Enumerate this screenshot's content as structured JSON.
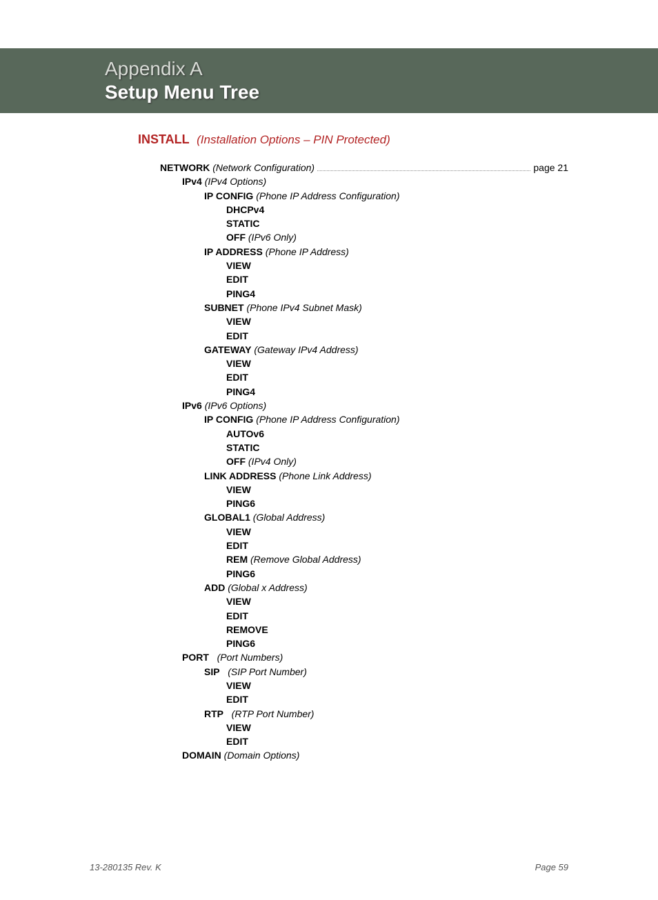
{
  "banner": {
    "appendix": "Appendix A",
    "title": "Setup Menu Tree"
  },
  "install": {
    "label": "INSTALL",
    "desc": "(Installation Options – PIN Protected)"
  },
  "network": {
    "label": "NETWORK",
    "desc": "(Network Configuration)",
    "page_ref": "page 21"
  },
  "ipv4": {
    "label": "IPv4",
    "desc": "(IPv4 Options)",
    "ipconfig": {
      "label": "IP CONFIG",
      "desc": "(Phone IP Address Configuration)"
    },
    "dhcpv4": "DHCPv4",
    "static": "STATIC",
    "off": {
      "label": "OFF",
      "desc": "(IPv6 Only)"
    },
    "ipaddress": {
      "label": "IP ADDRESS",
      "desc": "(Phone IP Address)"
    },
    "view1": "VIEW",
    "edit1": "EDIT",
    "ping4_1": "PING4",
    "subnet": {
      "label": "SUBNET",
      "desc": "(Phone IPv4 Subnet Mask)"
    },
    "view2": "VIEW",
    "edit2": "EDIT",
    "gateway": {
      "label": "GATEWAY",
      "desc": "(Gateway IPv4 Address)"
    },
    "view3": "VIEW",
    "edit3": "EDIT",
    "ping4_2": "PING4"
  },
  "ipv6": {
    "label": "IPv6",
    "desc": "(IPv6 Options)",
    "ipconfig": {
      "label": "IP CONFIG",
      "desc": "(Phone IP Address Configuration)"
    },
    "autov6": "AUTOv6",
    "static": "STATIC",
    "off": {
      "label": "OFF",
      "desc": "(IPv4 Only)"
    },
    "linkaddress": {
      "label": "LINK ADDRESS",
      "desc": "(Phone Link Address)"
    },
    "view1": "VIEW",
    "ping6_1": "PING6",
    "global1": {
      "label": "GLOBAL1",
      "desc": "(Global Address)"
    },
    "view2": "VIEW",
    "edit2": "EDIT",
    "rem": {
      "label": "REM",
      "desc": "(Remove Global Address)"
    },
    "ping6_2": "PING6",
    "add": {
      "label": "ADD",
      "desc": "(Global x Address)"
    },
    "view3": "VIEW",
    "edit3": "EDIT",
    "remove": "REMOVE",
    "ping6_3": "PING6"
  },
  "port": {
    "label": "PORT",
    "desc": "(Port Numbers)",
    "sip": {
      "label": "SIP",
      "desc": "(SIP Port Number)"
    },
    "view1": "VIEW",
    "edit1": "EDIT",
    "rtp": {
      "label": "RTP",
      "desc": "(RTP Port Number)"
    },
    "view2": "VIEW",
    "edit2": "EDIT"
  },
  "domain": {
    "label": "DOMAIN",
    "desc": "(Domain Options)"
  },
  "footer": {
    "left": "13-280135  Rev. K",
    "right": "Page 59"
  }
}
